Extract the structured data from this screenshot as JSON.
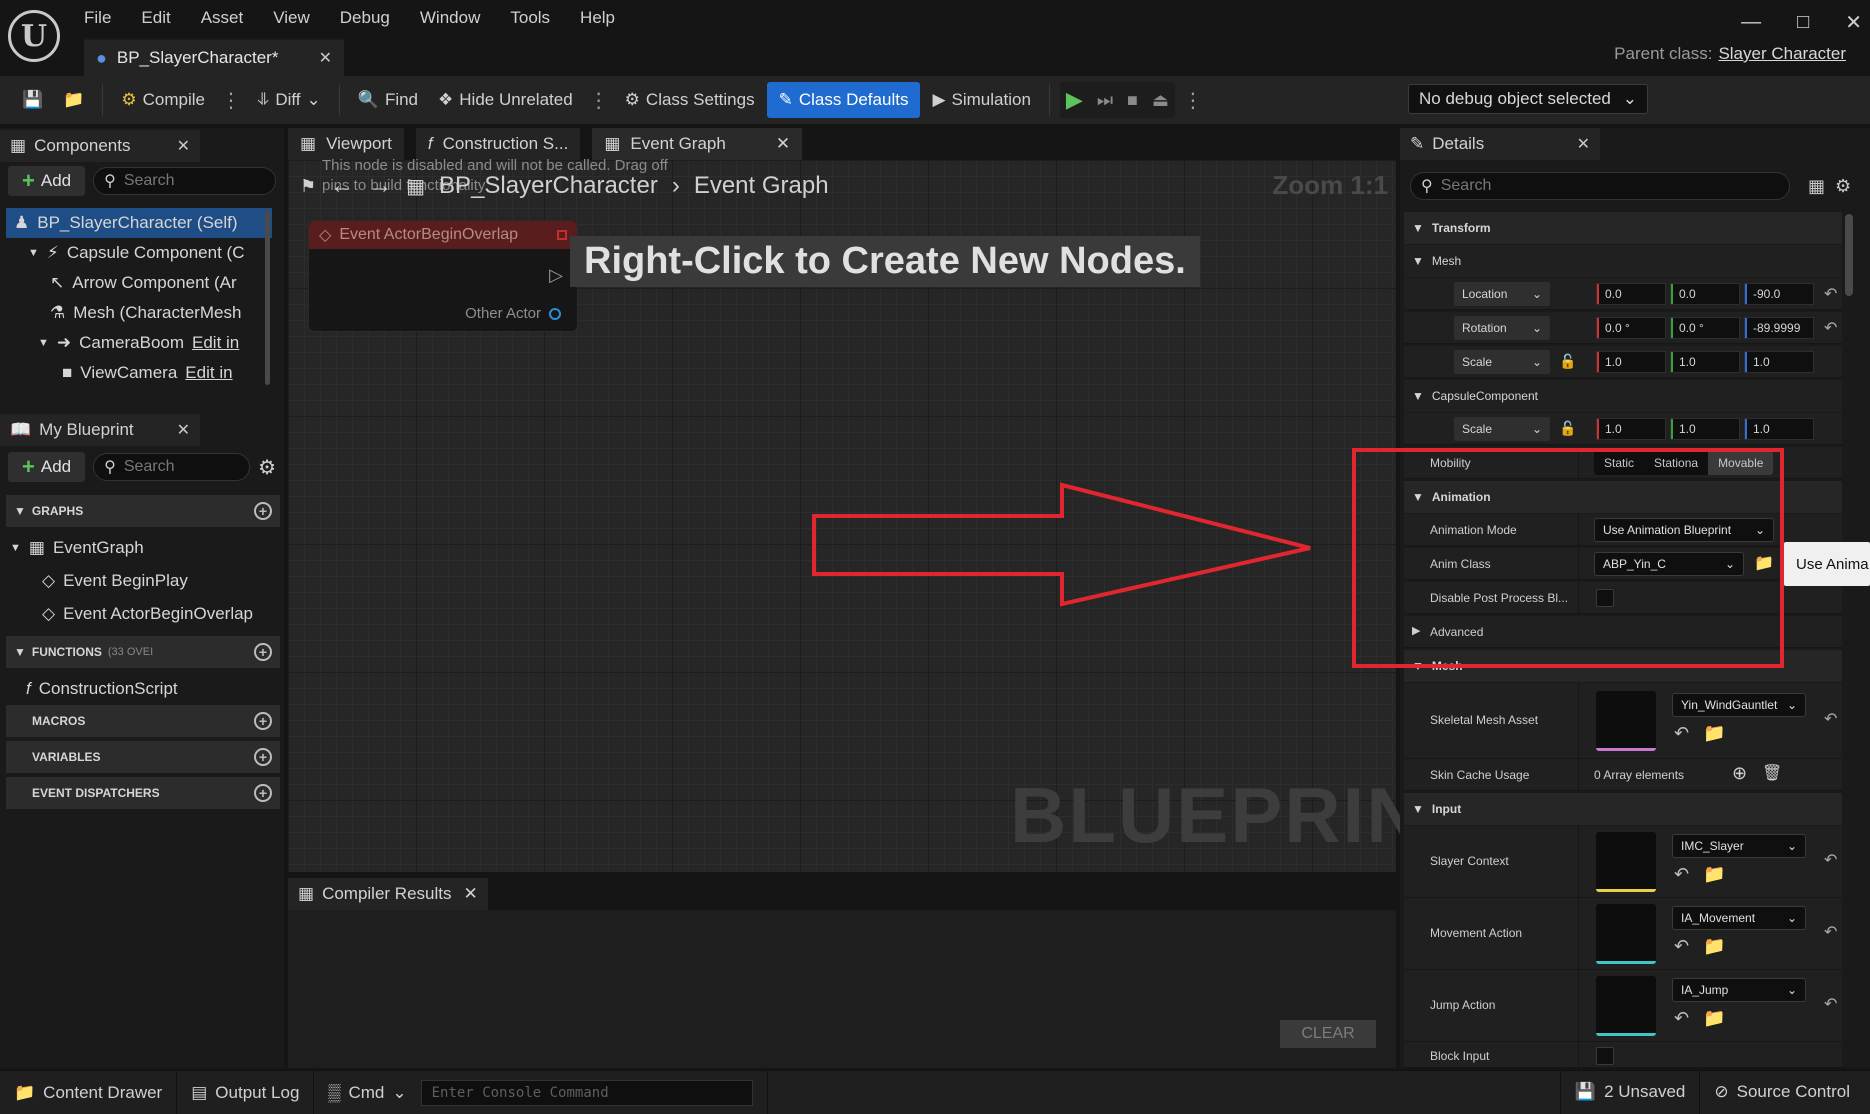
{
  "menu": [
    "File",
    "Edit",
    "Asset",
    "View",
    "Debug",
    "Window",
    "Tools",
    "Help"
  ],
  "document_tab": "BP_SlayerCharacter*",
  "parent_class": {
    "label": "Parent class:",
    "value": "Slayer Character"
  },
  "toolbar": {
    "compile": "Compile",
    "diff": "Diff",
    "find": "Find",
    "hide_unrelated": "Hide Unrelated",
    "class_settings": "Class Settings",
    "class_defaults": "Class Defaults",
    "simulation": "Simulation",
    "debug_object": "No debug object selected"
  },
  "components": {
    "tab": "Components",
    "add": "Add",
    "search_placeholder": "Search",
    "items": [
      {
        "label": "BP_SlayerCharacter (Self)",
        "link": ""
      },
      {
        "label": "Capsule Component (C",
        "link": ""
      },
      {
        "label": "Arrow Component (Ar",
        "link": ""
      },
      {
        "label": "Mesh (CharacterMesh",
        "link": ""
      },
      {
        "label": "CameraBoom",
        "link": "Edit in"
      },
      {
        "label": "ViewCamera",
        "link": "Edit in"
      }
    ]
  },
  "my_blueprint": {
    "tab": "My Blueprint",
    "add": "Add",
    "search_placeholder": "Search",
    "graphs": "GRAPHS",
    "event_graph": "EventGraph",
    "events": [
      "Event BeginPlay",
      "Event ActorBeginOverlap"
    ],
    "functions": "FUNCTIONS",
    "functions_sub": "(33 OVEI",
    "construction_script": "ConstructionScript",
    "macros": "MACROS",
    "variables": "VARIABLES",
    "dispatchers": "EVENT DISPATCHERS"
  },
  "graph": {
    "tabs": [
      "Viewport",
      "Construction S...",
      "Event Graph"
    ],
    "breadcrumb": [
      "BP_SlayerCharacter",
      "Event Graph"
    ],
    "zoom": "Zoom 1:1",
    "disabled_note": "This node is disabled and will not be called. Drag off pins to build functionality.",
    "node_title": "Event ActorBeginOverlap",
    "node_pin": "Other Actor",
    "hint": "Right-Click to Create New Nodes.",
    "watermark": "BLUEPRINT"
  },
  "compiler": {
    "tab": "Compiler Results",
    "clear": "CLEAR"
  },
  "details": {
    "tab": "Details",
    "search_placeholder": "Search",
    "transform": "Transform",
    "mesh": "Mesh",
    "location": {
      "label": "Location",
      "x": "0.0",
      "y": "0.0",
      "z": "-90.0"
    },
    "rotation": {
      "label": "Rotation",
      "x": "0.0 °",
      "y": "0.0 °",
      "z": "-89.9999"
    },
    "scale": {
      "label": "Scale",
      "x": "1.0",
      "y": "1.0",
      "z": "1.0"
    },
    "capsule": "CapsuleComponent",
    "capsule_scale": {
      "label": "Scale",
      "x": "1.0",
      "y": "1.0",
      "z": "1.0"
    },
    "mobility": {
      "label": "Mobility",
      "options": [
        "Static",
        "Stationa",
        "Movable"
      ],
      "selected": "Movable"
    },
    "animation": "Animation",
    "animation_mode": {
      "label": "Animation Mode",
      "value": "Use Animation Blueprint"
    },
    "anim_class": {
      "label": "Anim Class",
      "value": "ABP_Yin_C"
    },
    "disable_pp": "Disable Post Process Bl...",
    "advanced": "Advanced",
    "mesh_section": "Mesh",
    "skeletal_mesh": {
      "label": "Skeletal Mesh Asset",
      "value": "Yin_WindGauntlet"
    },
    "skin_cache": {
      "label": "Skin Cache Usage",
      "value": "0 Array elements"
    },
    "input": "Input",
    "slayer_context": {
      "label": "Slayer Context",
      "value": "IMC_Slayer"
    },
    "movement_action": {
      "label": "Movement Action",
      "value": "IA_Movement"
    },
    "jump_action": {
      "label": "Jump Action",
      "value": "IA_Jump"
    },
    "block_input": "Block Input",
    "tooltip": "Use Anima"
  },
  "statusbar": {
    "content_drawer": "Content Drawer",
    "output_log": "Output Log",
    "cmd": "Cmd",
    "console_placeholder": "Enter Console Command",
    "unsaved": "2 Unsaved",
    "source_control": "Source Control"
  },
  "colors": {
    "accent": "#1f6bd0",
    "annotation": "#e22630",
    "play": "#5cc45c"
  }
}
